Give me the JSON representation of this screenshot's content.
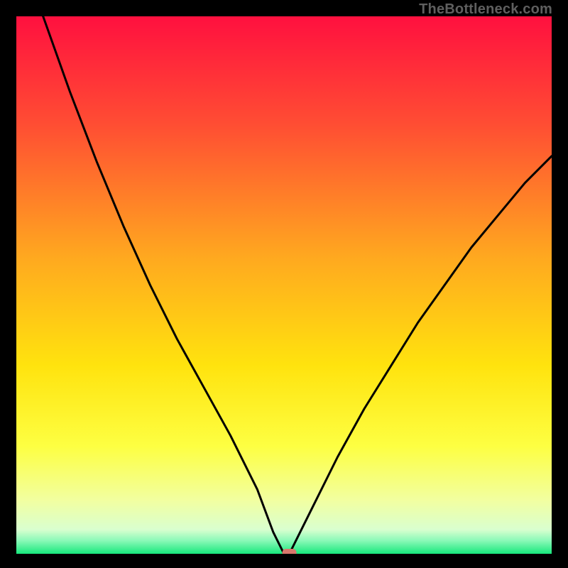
{
  "watermark": "TheBottleneck.com",
  "chart_data": {
    "type": "line",
    "title": "",
    "xlabel": "",
    "ylabel": "",
    "xlim": [
      0,
      100
    ],
    "ylim": [
      0,
      100
    ],
    "grid": false,
    "x": [
      0,
      5,
      10,
      15,
      20,
      25,
      30,
      35,
      40,
      45,
      48,
      50,
      51,
      52,
      55,
      60,
      65,
      70,
      75,
      80,
      85,
      90,
      95,
      100
    ],
    "values": [
      115,
      100,
      86,
      73,
      61,
      50,
      40,
      31,
      22,
      12,
      4,
      0,
      0,
      2,
      8,
      18,
      27,
      35,
      43,
      50,
      57,
      63,
      69,
      74
    ],
    "minimum_x": 50,
    "gradient_stops": [
      {
        "pos": 0.0,
        "color": "#ff103f"
      },
      {
        "pos": 0.2,
        "color": "#ff4d33"
      },
      {
        "pos": 0.45,
        "color": "#ffa91f"
      },
      {
        "pos": 0.65,
        "color": "#ffe30e"
      },
      {
        "pos": 0.8,
        "color": "#fdff42"
      },
      {
        "pos": 0.9,
        "color": "#f2ffa0"
      },
      {
        "pos": 0.955,
        "color": "#d9ffcf"
      },
      {
        "pos": 0.975,
        "color": "#8cf9b8"
      },
      {
        "pos": 1.0,
        "color": "#17e87c"
      }
    ],
    "marker": {
      "x": 51,
      "y": 0,
      "color": "#d9776c"
    }
  }
}
